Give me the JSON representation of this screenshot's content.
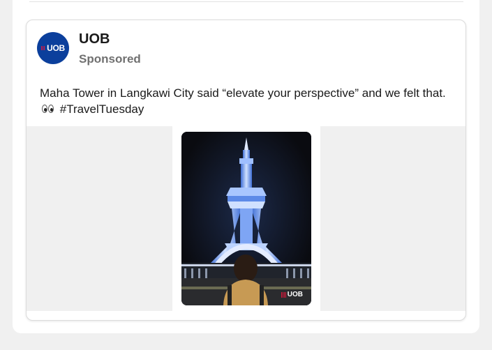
{
  "post": {
    "advertiser_name": "UOB",
    "sponsored_label": "Sponsored",
    "avatar_logo_text": "UOB",
    "text_before_emoji": "Maha Tower in Langkawi City said “elevate your perspective” and we felt that.",
    "emoji": "eyes-emoji",
    "hashtag": "#TravelTuesday",
    "image_watermark_text": "UOB"
  },
  "colors": {
    "page_background": "#f0f0f0",
    "card_background": "#ffffff",
    "brand_blue": "#0b3f9c",
    "brand_red": "#e4153b",
    "sponsored_gray": "#707070",
    "tower_light": "#6f9cf0"
  },
  "icons": {
    "avatar": "uob-logo-icon",
    "emoji": "eyes-emoji-icon",
    "watermark": "uob-logo-icon"
  }
}
